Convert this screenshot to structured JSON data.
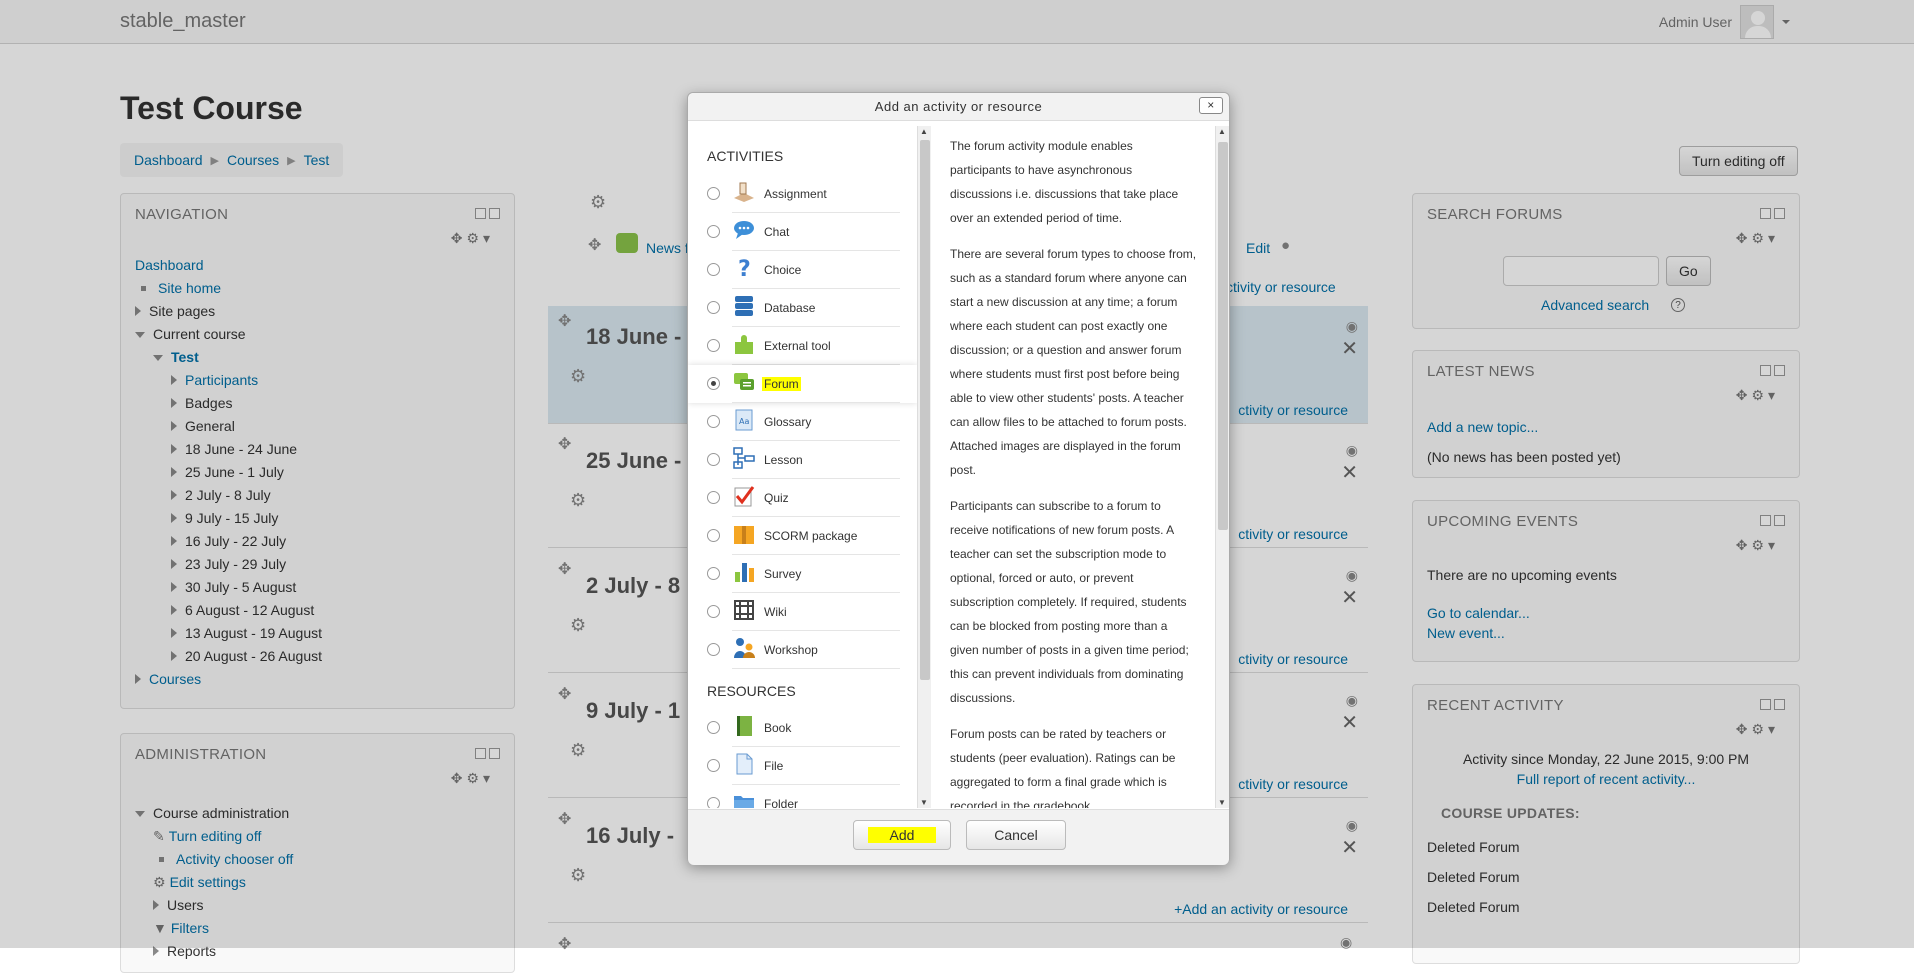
{
  "site": {
    "name": "stable_master",
    "user": "Admin User"
  },
  "page": {
    "title": "Test Course",
    "breadcrumb": [
      "Dashboard",
      "Courses",
      "Test"
    ],
    "turn_editing_off": "Turn editing off"
  },
  "navigation": {
    "title": "NAVIGATION",
    "dashboard": "Dashboard",
    "site_home": "Site home",
    "site_pages": "Site pages",
    "current_course": "Current course",
    "course": "Test",
    "items": [
      "Participants",
      "Badges",
      "General",
      "18 June - 24 June",
      "25 June - 1 July",
      "2 July - 8 July",
      "9 July - 15 July",
      "16 July - 22 July",
      "23 July - 29 July",
      "30 July - 5 August",
      "6 August - 12 August",
      "13 August - 19 August",
      "20 August - 26 August"
    ],
    "courses": "Courses"
  },
  "administration": {
    "title": "ADMINISTRATION",
    "course_admin": "Course administration",
    "items": [
      "Turn editing off",
      "Activity chooser off",
      "Edit settings"
    ],
    "users": "Users",
    "filters": "Filters",
    "reports": "Reports"
  },
  "main": {
    "news_partial": "News f",
    "edit": "Edit",
    "add_activity": "Add an activity or resource",
    "add_activity_partial": "ctivity or resource",
    "sections": [
      "18 June -",
      "25 June -",
      "2 July - 8",
      "9 July - 1",
      "16 July -"
    ]
  },
  "search_forums": {
    "title": "SEARCH FORUMS",
    "go": "Go",
    "advanced": "Advanced search"
  },
  "latest_news": {
    "title": "LATEST NEWS",
    "add_topic": "Add a new topic...",
    "none": "(No news has been posted yet)"
  },
  "upcoming_events": {
    "title": "UPCOMING EVENTS",
    "none": "There are no upcoming events",
    "calendar": "Go to calendar...",
    "new_event": "New event..."
  },
  "recent_activity": {
    "title": "RECENT ACTIVITY",
    "since": "Activity since Monday, 22 June 2015, 9:00 PM",
    "full_report": "Full report of recent activity...",
    "course_updates": "COURSE UPDATES:",
    "updates": [
      "Deleted Forum",
      "Deleted Forum",
      "Deleted Forum"
    ]
  },
  "dialog": {
    "title": "Add an activity or resource",
    "close": "×",
    "activities_heading": "ACTIVITIES",
    "activities": [
      "Assignment",
      "Chat",
      "Choice",
      "Database",
      "External tool",
      "Forum",
      "Glossary",
      "Lesson",
      "Quiz",
      "SCORM package",
      "Survey",
      "Wiki",
      "Workshop"
    ],
    "selected": "Forum",
    "resources_heading": "RESOURCES",
    "resources": [
      "Book",
      "File",
      "Folder"
    ],
    "description": [
      "The forum activity module enables participants to have asynchronous discussions i.e. discussions that take place over an extended period of time.",
      "There are several forum types to choose from, such as a standard forum where anyone can start a new discussion at any time; a forum where each student can post exactly one discussion; or a question and answer forum where students must first post before being able to view other students' posts. A teacher can allow files to be attached to forum posts. Attached images are displayed in the forum post.",
      "Participants can subscribe to a forum to receive notifications of new forum posts. A teacher can set the subscription mode to optional, forced or auto, or prevent subscription completely. If required, students can be blocked from posting more than a given number of posts in a given time period; this can prevent individuals from dominating discussions.",
      "Forum posts can be rated by teachers or students (peer evaluation). Ratings can be aggregated to form a final grade which is recorded in the gradebook."
    ],
    "add": "Add",
    "cancel": "Cancel"
  }
}
